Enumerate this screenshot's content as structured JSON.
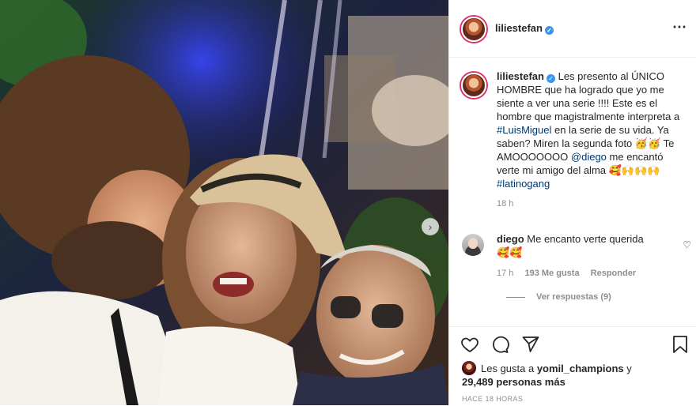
{
  "post": {
    "author": "liliestefan",
    "verified_mark": "✓",
    "more_icon": "more-options",
    "caption": {
      "lead": "Les presento al ÚNICO HOMBRE que ha logrado que yo me siente a ver una serie !!!! Este es el hombre que magistralmente interpreta a ",
      "hashtag1": "#LuisMiguel",
      "mid": " en la serie de su vida. Ya saben? Miren la segunda foto 🥳🥳 Te AMOOOOOOO ",
      "mention": "@diego",
      "tail": " me encantó verte mi amigo del alma 🥰🙌🙌🙌 ",
      "hashtag2": "#latinogang",
      "time": "18 h"
    },
    "comment": {
      "user": "diego",
      "text": "Me encanto verte querida 🥰🥰",
      "time": "17 h",
      "likes": "193 Me gusta",
      "reply": "Responder",
      "view_replies": "Ver respuestas (9)"
    },
    "likes": {
      "prefix": "Les gusta a ",
      "user": "yomil_champions",
      "joiner": " y",
      "count": "29,489 personas más"
    },
    "timestamp": "HACE 18 HORAS",
    "colors": {
      "link": "#00376b",
      "verified": "#3897f0",
      "secondary": "#8e8e8e",
      "story_ring": "#e1306c"
    }
  }
}
